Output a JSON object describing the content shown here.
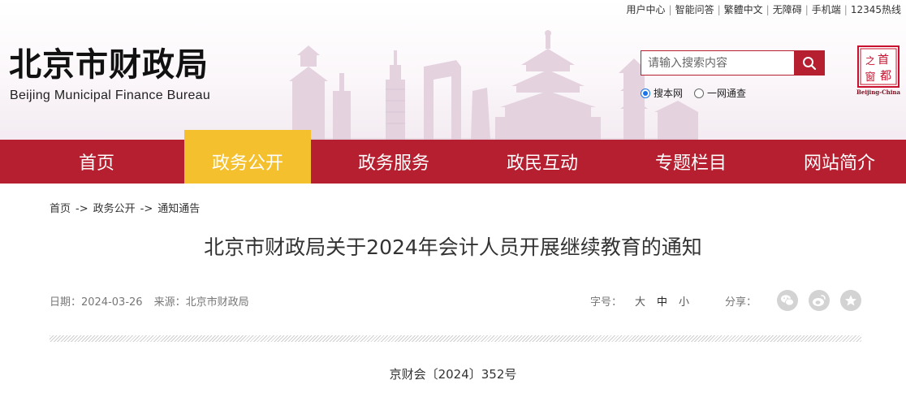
{
  "top_links": [
    "用户中心",
    "智能问答",
    "繁體中文",
    "无障碍",
    "手机端",
    "12345热线"
  ],
  "brand": {
    "title_cn": "北京市财政局",
    "title_en": "Beijing Municipal Finance Bureau"
  },
  "search": {
    "placeholder": "请输入搜索内容",
    "scope_options": [
      "搜本网",
      "一网通查"
    ],
    "selected_scope": "搜本网"
  },
  "capital_logo": {
    "chars": [
      "首",
      "都",
      "之",
      "窗"
    ],
    "caption": "Beijing-China"
  },
  "nav": {
    "items": [
      "首页",
      "政务公开",
      "政务服务",
      "政民互动",
      "专题栏目",
      "网站简介"
    ],
    "active": "政务公开"
  },
  "breadcrumb": {
    "items": [
      "首页",
      "政务公开",
      "通知通告"
    ],
    "separator": "->"
  },
  "article": {
    "title": "北京市财政局关于2024年会计人员开展继续教育的通知",
    "date_label": "日期：",
    "date": "2024-03-26",
    "source_label": "来源：",
    "source": "北京市财政局",
    "font_size_label": "字号：",
    "font_sizes": [
      "大",
      "中",
      "小"
    ],
    "selected_font_size": "中",
    "share_label": "分享：",
    "share_icons": [
      "wechat-icon",
      "weibo-icon",
      "favorite-star-icon"
    ],
    "doc_number": "京财会〔2024〕352号"
  },
  "colors": {
    "nav_red": "#b51f2f",
    "nav_active_yellow": "#f5c02d",
    "radio_blue": "#1a73e8",
    "share_gray": "#d3d3d3"
  }
}
